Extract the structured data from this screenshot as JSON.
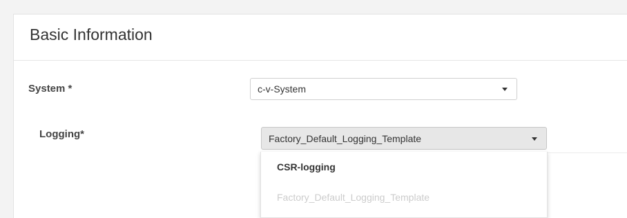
{
  "section": {
    "title": "Basic Information"
  },
  "fields": {
    "system": {
      "label": "System *",
      "value": "c-v-System"
    },
    "logging": {
      "label": "Logging*",
      "value": "Factory_Default_Logging_Template",
      "options": [
        {
          "label": "CSR-logging",
          "state": "active"
        },
        {
          "label": "Factory_Default_Logging_Template",
          "state": "disabled"
        }
      ]
    }
  },
  "colors": {
    "selected_select_bg": "#e7e7e7",
    "disabled_option_text": "#cccccc"
  }
}
